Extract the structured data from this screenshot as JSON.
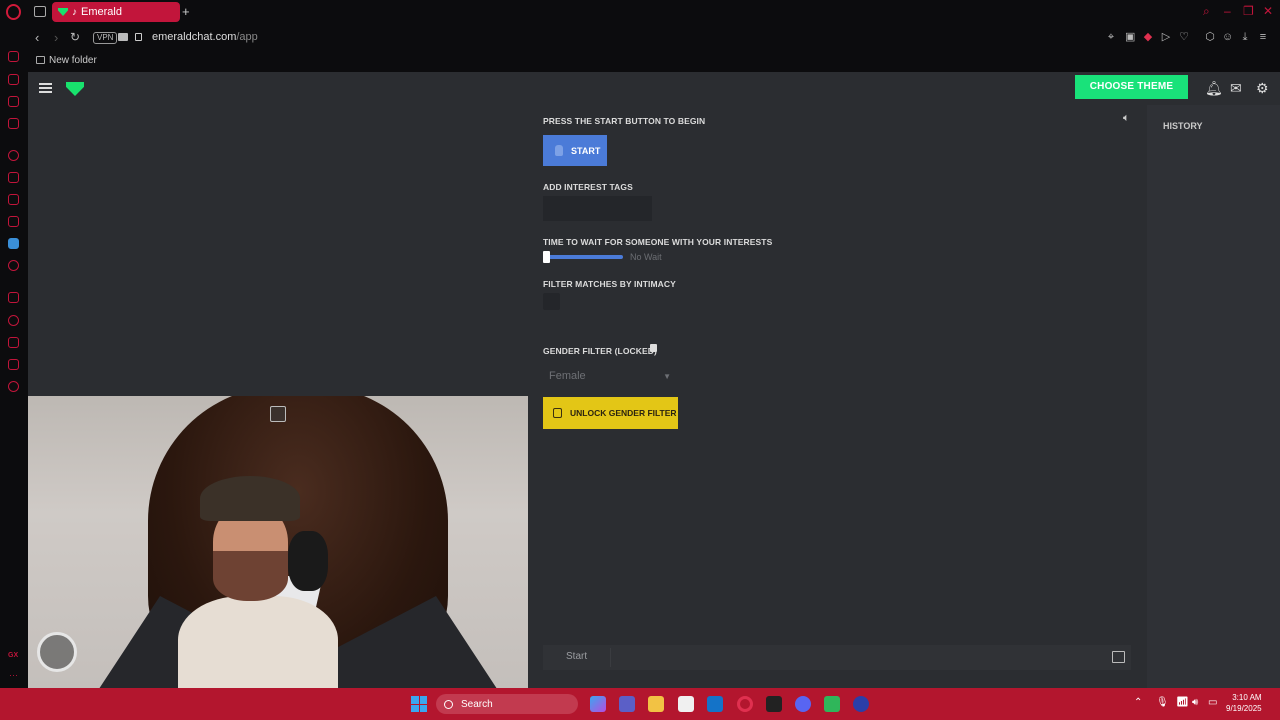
{
  "browser": {
    "tab_title": "Emerald",
    "url_host": "emeraldchat.com",
    "url_path": "/app",
    "vpn_label": "VPN",
    "bookmark_folder": "New folder"
  },
  "header": {
    "choose_theme_label": "CHOOSE THEME"
  },
  "main": {
    "start_prompt": "PRESS THE START BUTTON TO BEGIN",
    "start_button_label": "START",
    "interest_tags_label": "ADD INTEREST TAGS",
    "interest_tags_value": "",
    "wait_time_label": "TIME TO WAIT FOR SOMEONE WITH YOUR INTERESTS",
    "wait_time_value_label": "No Wait",
    "wait_time_fraction": 0,
    "intimacy_filter_label": "FILTER MATCHES BY INTIMACY",
    "intimacy_filter_enabled": false,
    "gender_filter_label": "GENDER FILTER (LOCKED)",
    "gender_selected": "Female",
    "unlock_gender_button_label": "UNLOCK GENDER FILTER"
  },
  "chat": {
    "placeholder": "Start"
  },
  "history": {
    "title": "HISTORY"
  },
  "taskbar": {
    "search_label": "Search",
    "time": "3:10 AM",
    "date": "9/19/2025"
  },
  "colors": {
    "accent_green": "#19e27a",
    "start_blue": "#4b7bd8",
    "unlock_yellow": "#e3c616",
    "opera_red": "#c2153b",
    "app_bg": "#2b2d31"
  },
  "icons": {
    "sidebar": [
      "opera-icon",
      "history-icon",
      "messenger-icon",
      "whatsapp-icon",
      "music-icon",
      "twitch-icon",
      "instagram-icon",
      "discord-icon",
      "telegram-icon",
      "vk-icon",
      "workspace-icon",
      "clock-icon",
      "download-icon",
      "chat-icon",
      "settings-icon"
    ]
  }
}
